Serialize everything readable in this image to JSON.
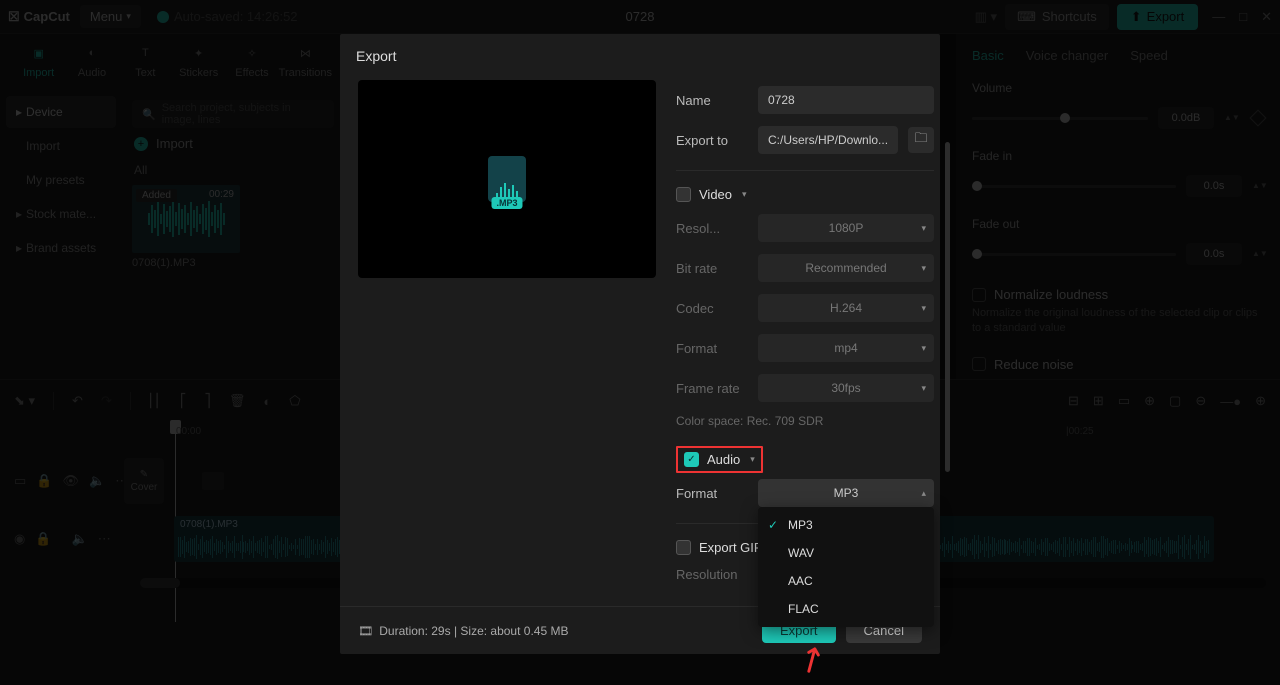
{
  "app": {
    "name": "CapCut",
    "menu": "Menu",
    "auto_saved": "Auto-saved: 14:26:52",
    "project": "0728",
    "shortcuts": "Shortcuts",
    "export": "Export"
  },
  "tools": {
    "import": "Import",
    "audio": "Audio",
    "text": "Text",
    "stickers": "Stickers",
    "effects": "Effects",
    "transitions": "Transitions"
  },
  "sidebar": {
    "device": "Device",
    "import": "Import",
    "presets": "My presets",
    "stock": "Stock mate...",
    "brand": "Brand assets"
  },
  "media": {
    "search_ph": "Search project, subjects in image, lines",
    "import": "Import",
    "all": "All",
    "thumb_badge": "Added",
    "thumb_time": "00:29",
    "thumb_name": "0708(1).MP3"
  },
  "props": {
    "tabs": {
      "basic": "Basic",
      "voice": "Voice changer",
      "speed": "Speed"
    },
    "volume": "Volume",
    "volume_val": "0.0dB",
    "fadein": "Fade in",
    "fadein_val": "0.0s",
    "fadeout": "Fade out",
    "fadeout_val": "0.0s",
    "normalize": "Normalize loudness",
    "normalize_desc": "Normalize the original loudness of the selected clip or clips to a standard value",
    "reduce": "Reduce noise"
  },
  "timeline": {
    "time0": "00:00",
    "time1": "|00:25",
    "clip_name": "0708(1).MP3",
    "cover": "Cover"
  },
  "modal": {
    "title": "Export",
    "name_label": "Name",
    "name_val": "0728",
    "exportto_label": "Export to",
    "exportto_val": "C:/Users/HP/Downlo...",
    "video": "Video",
    "res_label": "Resol...",
    "res_val": "1080P",
    "bitrate_label": "Bit rate",
    "bitrate_val": "Recommended",
    "codec_label": "Codec",
    "codec_val": "H.264",
    "vformat_label": "Format",
    "vformat_val": "mp4",
    "framerate_label": "Frame rate",
    "framerate_val": "30fps",
    "colorspace": "Color space: Rec. 709 SDR",
    "audio": "Audio",
    "aformat_label": "Format",
    "aformat_val": "MP3",
    "aopts": [
      "MP3",
      "WAV",
      "AAC",
      "FLAC"
    ],
    "gif": "Export GIF",
    "gif_res_label": "Resolution",
    "mp3_tag": ".MP3",
    "duration": "Duration: 29s | Size: about 0.45 MB",
    "export_btn": "Export",
    "cancel_btn": "Cancel"
  }
}
